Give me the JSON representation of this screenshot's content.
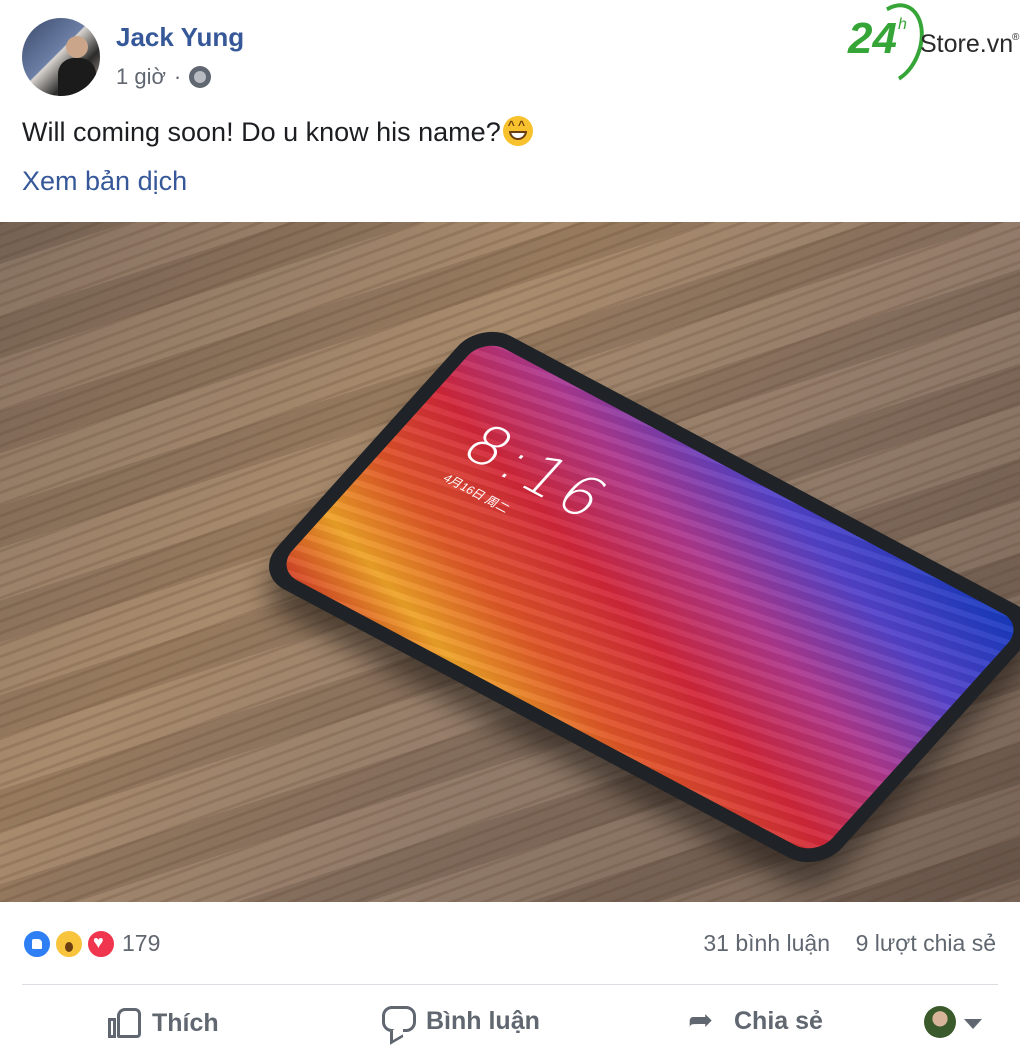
{
  "post": {
    "author": "Jack Yung",
    "time": "1 giờ",
    "separator": "·",
    "text": "Will coming soon! Do u know his name?",
    "translate_label": "Xem bản dịch"
  },
  "watermark": {
    "number": "24",
    "superscript": "h",
    "brand": "Store.vn",
    "registered": "®"
  },
  "photo": {
    "clock": "8:16",
    "date": "4月16日 周二"
  },
  "stats": {
    "reactions_count": "179",
    "comments": "31 bình luận",
    "shares": "9 lượt chia sẻ",
    "reaction_icons": [
      "like-icon",
      "wow-icon",
      "love-icon"
    ]
  },
  "actions": {
    "like": "Thích",
    "comment": "Bình luận",
    "share": "Chia sẻ"
  },
  "colors": {
    "link": "#365899",
    "secondary_text": "#606770",
    "brand_green": "#36a537",
    "like_blue": "#2e7ef4",
    "love_red": "#f0364e"
  }
}
